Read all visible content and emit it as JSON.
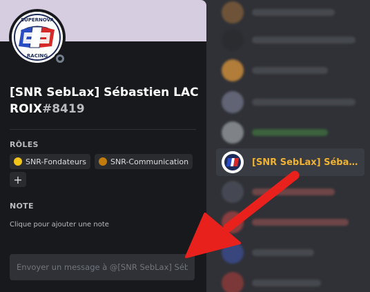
{
  "profile": {
    "username": "[SNR SebLax] Sébastien LACROIX",
    "discriminator": "#8419",
    "avatar_logo_text": [
      "SUPERNOVA",
      "RACING"
    ],
    "status": "offline"
  },
  "roles_section": {
    "title": "RÔLES",
    "roles": [
      {
        "name": "SNR-Fondateurs",
        "color": "#f0c419"
      },
      {
        "name": "SNR-Communication",
        "color": "#c27c0e"
      }
    ],
    "add_label": "+"
  },
  "note_section": {
    "title": "NOTE",
    "placeholder": "Clique pour ajouter une note"
  },
  "message": {
    "placeholder": "Envoyer un message à @[SNR SebLax] Sébastien LACROIX"
  },
  "member_list": {
    "active_member": {
      "name": "[SNR SebLax] Sébasti…",
      "color": "#f0b232"
    }
  },
  "annotation": {
    "arrow_color": "#e8211c"
  }
}
